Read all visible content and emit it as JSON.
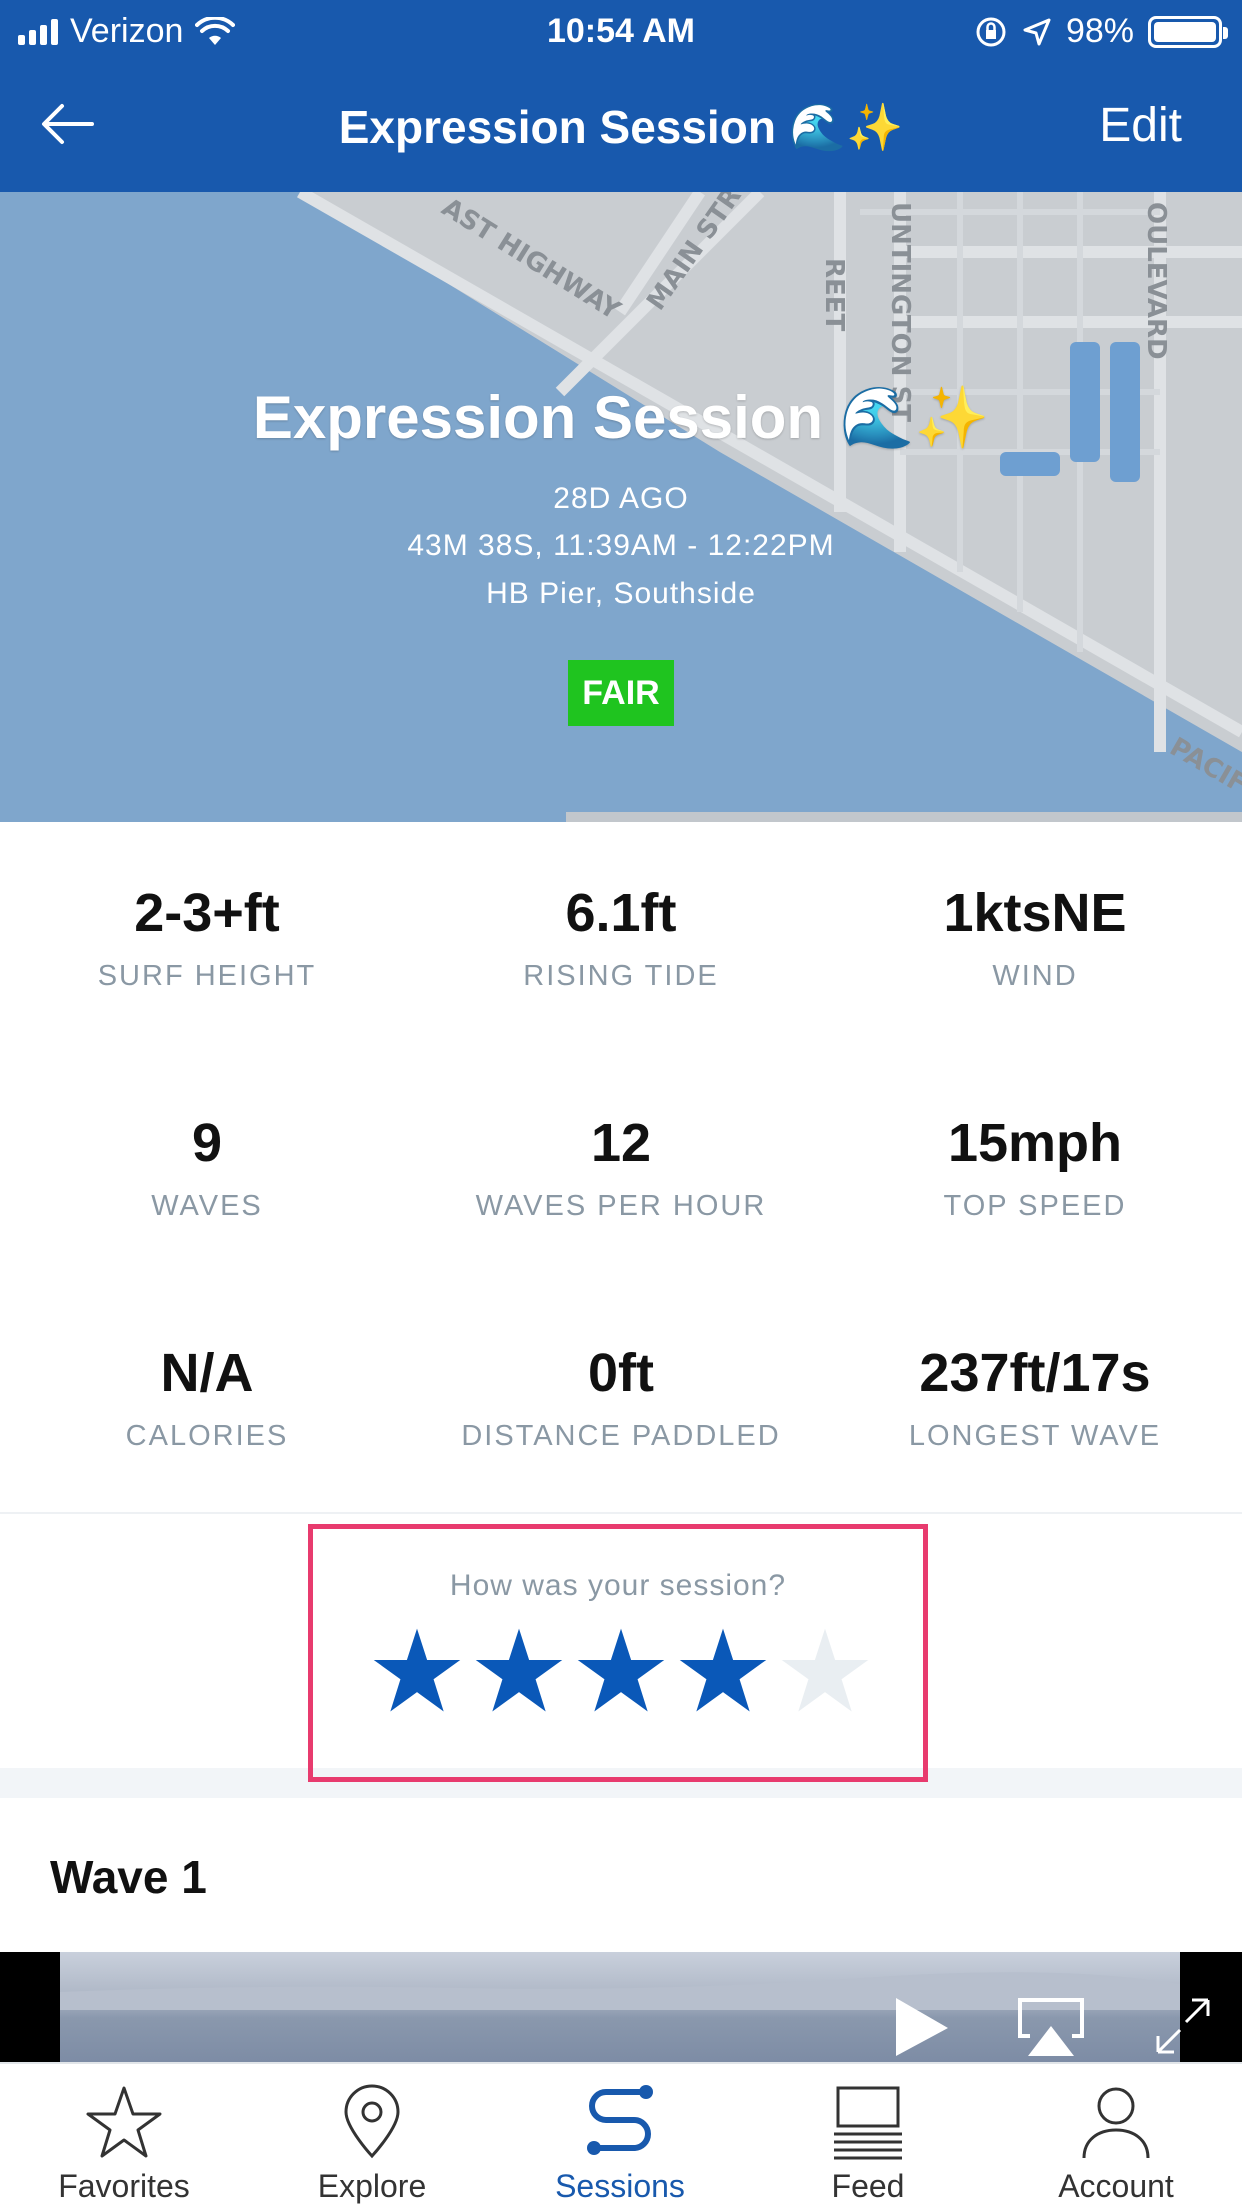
{
  "status_bar": {
    "carrier": "Verizon",
    "time": "10:54 AM",
    "battery": "98%"
  },
  "nav": {
    "title": "Expression Session 🌊✨",
    "edit_label": "Edit"
  },
  "map": {
    "labels": [
      "AST HIGHWAY",
      "MAIN STR",
      "REET",
      "UNTINGTON ST",
      "OULEVARD",
      "PACIF"
    ]
  },
  "hero": {
    "title": "Expression Session 🌊✨",
    "ago": "28D AGO",
    "time_range": "43M 38S, 11:39AM - 12:22PM",
    "spot": "HB Pier, Southside",
    "condition": "FAIR",
    "condition_color": "#1fc41f"
  },
  "stats": [
    {
      "value": "2-3+ft",
      "label": "SURF HEIGHT"
    },
    {
      "value": "6.1ft",
      "label": "RISING TIDE"
    },
    {
      "value": "1ktsNE",
      "label": "WIND"
    },
    {
      "value": "9",
      "label": "WAVES"
    },
    {
      "value": "12",
      "label": "WAVES PER HOUR"
    },
    {
      "value": "15mph",
      "label": "TOP SPEED"
    },
    {
      "value": "N/A",
      "label": "CALORIES"
    },
    {
      "value": "0ft",
      "label": "DISTANCE PADDLED"
    },
    {
      "value": "237ft/17s",
      "label": "LONGEST WAVE"
    }
  ],
  "rating": {
    "question": "How was your session?",
    "value": 4,
    "max": 5,
    "filled_color": "#0a58b8",
    "empty_color": "#e9eef2"
  },
  "wave_section": {
    "title": "Wave 1"
  },
  "tabs": [
    {
      "label": "Favorites",
      "icon": "star-icon"
    },
    {
      "label": "Explore",
      "icon": "location-pin-icon"
    },
    {
      "label": "Sessions",
      "icon": "sessions-path-icon",
      "active": true
    },
    {
      "label": "Feed",
      "icon": "feed-icon"
    },
    {
      "label": "Account",
      "icon": "person-icon"
    }
  ],
  "colors": {
    "brand_blue": "#1859ad",
    "highlight_border": "#e83b6e"
  }
}
